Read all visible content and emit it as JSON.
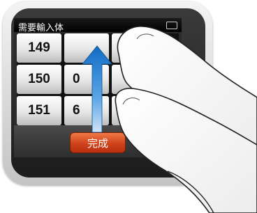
{
  "screen": {
    "title": "需要輸入体",
    "picker_column_1": [
      "149",
      "150",
      "151"
    ],
    "picker_column_2": [
      "",
      "0",
      "6"
    ],
    "picker_column_3": [
      "",
      "",
      ""
    ],
    "done_label": "完成"
  },
  "gesture": {
    "type": "swipe-up",
    "arrow_color": "#1b7fd0"
  },
  "colors": {
    "done_button": "#d0431c",
    "device_body": "#d9d9d9"
  }
}
